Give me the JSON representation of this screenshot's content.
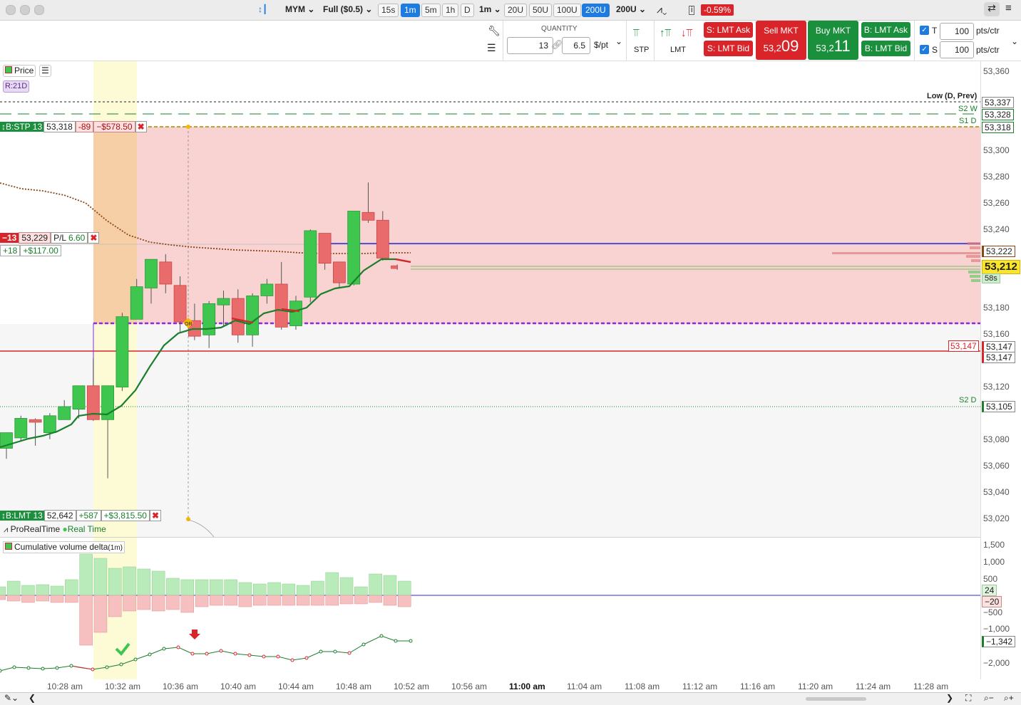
{
  "toolbar": {
    "symbol": "MYM",
    "data_mode": "Full ($0.5)",
    "timeframes": [
      "15s",
      "1m",
      "5m",
      "1h",
      "D"
    ],
    "active_timeframe": "1m",
    "interval": "1m",
    "ranges": [
      "20U",
      "50U",
      "100U",
      "200U"
    ],
    "active_range": "200U",
    "range_select": "200U",
    "change_pct": "-0.59%"
  },
  "order_entry": {
    "quantity_label": "QUANTITY",
    "quantity": "13",
    "dollar_per_pt": "6.5",
    "dollar_unit": "$/pt",
    "stp_label": "STP",
    "lmt_label": "LMT",
    "s_lmt_ask": "S: LMT Ask",
    "s_lmt_bid": "S: LMT Bid",
    "sell_mkt": "Sell MKT",
    "sell_price_small": "53,2",
    "sell_price_big": "09",
    "buy_mkt": "Buy MKT",
    "buy_price_small": "53,2",
    "buy_price_big": "11",
    "b_lmt_ask": "B: LMT Ask",
    "b_lmt_bid": "B: LMT Bid",
    "target_label": "T",
    "target_value": "100",
    "stop_label": "S",
    "stop_value": "100",
    "pts_unit": "pts/ctr"
  },
  "chart_header": {
    "price_button": "Price",
    "range_badge": "R:21D",
    "feed_name": "ProRealTime",
    "feed_status": "Real Time",
    "indicator": "Cumulative volume delta",
    "indicator_tf": "(1m)"
  },
  "orders": {
    "stop": {
      "label": "B:STP 13",
      "price": "53,318",
      "pts": "-89",
      "pnl": "−$578.50"
    },
    "position": {
      "qty": "−13",
      "price": "53,229",
      "pl_label": "P/L",
      "pl_value": "6.60",
      "pts": "+18",
      "pnl": "+$117.00"
    },
    "limit": {
      "label": "B:LMT 13",
      "price": "52,642",
      "pts": "+587",
      "pnl": "+$3,815.50"
    }
  },
  "level_labels": {
    "low_prev": "Low (D, Prev)",
    "s2w": "S2 W",
    "s1d": "S1 D",
    "s2d": "S2 D",
    "red_line_price": "53,147",
    "or_marker": "OR"
  },
  "price_axis": {
    "ticks": [
      "53,360",
      "53,300",
      "53,280",
      "53,260",
      "53,240",
      "53,180",
      "53,160",
      "53,120",
      "53,080",
      "53,060",
      "53,040",
      "53,020"
    ],
    "tags": {
      "low_prev": "53,337",
      "s2w": "53,328",
      "s1d": "53,318",
      "vwap": "53,222",
      "last": "53,212",
      "countdown": "58s",
      "red1": "53,147",
      "red2": "53,147",
      "s2d": "53,105"
    }
  },
  "cvd_axis": {
    "ticks": [
      "1,500",
      "1,000",
      "500",
      "−500",
      "−1,000",
      "−2,000"
    ],
    "tags": {
      "pos": "24",
      "neg": "−20",
      "cum": "−1,342"
    }
  },
  "time_axis": [
    "10:28 am",
    "10:32 am",
    "10:36 am",
    "10:40 am",
    "10:44 am",
    "10:48 am",
    "10:52 am",
    "10:56 am",
    "11:00 am",
    "11:04 am",
    "11:08 am",
    "11:12 am",
    "11:16 am",
    "11:20 am",
    "11:24 am",
    "11:28 am"
  ],
  "chart_data": {
    "type": "candlestick",
    "y_range": [
      53005,
      53370
    ],
    "candles": [
      {
        "o": 53073,
        "h": 53082,
        "l": 53065,
        "c": 53085
      },
      {
        "o": 53081,
        "h": 53098,
        "l": 53079,
        "c": 53096
      },
      {
        "o": 53095,
        "h": 53096,
        "l": 53075,
        "c": 53093
      },
      {
        "o": 53085,
        "h": 53100,
        "l": 53080,
        "c": 53098
      },
      {
        "o": 53095,
        "h": 53110,
        "l": 53095,
        "c": 53105
      },
      {
        "o": 53103,
        "h": 53120,
        "l": 53096,
        "c": 53121
      },
      {
        "o": 53121,
        "h": 53142,
        "l": 53094,
        "c": 53095
      },
      {
        "o": 53095,
        "h": 53120,
        "l": 53050,
        "c": 53121
      },
      {
        "o": 53120,
        "h": 53177,
        "l": 53117,
        "c": 53174
      },
      {
        "o": 53172,
        "h": 53203,
        "l": 53172,
        "c": 53197
      },
      {
        "o": 53196,
        "h": 53216,
        "l": 53184,
        "c": 53218
      },
      {
        "o": 53216,
        "h": 53222,
        "l": 53192,
        "c": 53199
      },
      {
        "o": 53198,
        "h": 53205,
        "l": 53162,
        "c": 53170
      },
      {
        "o": 53171,
        "h": 53184,
        "l": 53156,
        "c": 53159
      },
      {
        "o": 53160,
        "h": 53186,
        "l": 53150,
        "c": 53184
      },
      {
        "o": 53183,
        "h": 53194,
        "l": 53166,
        "c": 53188
      },
      {
        "o": 53188,
        "h": 53195,
        "l": 53154,
        "c": 53160
      },
      {
        "o": 53160,
        "h": 53192,
        "l": 53151,
        "c": 53190
      },
      {
        "o": 53190,
        "h": 53203,
        "l": 53184,
        "c": 53199
      },
      {
        "o": 53199,
        "h": 53216,
        "l": 53164,
        "c": 53166
      },
      {
        "o": 53167,
        "h": 53190,
        "l": 53164,
        "c": 53186
      },
      {
        "o": 53189,
        "h": 53241,
        "l": 53185,
        "c": 53240
      },
      {
        "o": 53238,
        "h": 53236,
        "l": 53210,
        "c": 53215
      },
      {
        "o": 53216,
        "h": 53215,
        "l": 53196,
        "c": 53200
      },
      {
        "o": 53199,
        "h": 53255,
        "l": 53198,
        "c": 53255
      },
      {
        "o": 53254,
        "h": 53277,
        "l": 53246,
        "c": 53248
      },
      {
        "o": 53248,
        "h": 53255,
        "l": 53217,
        "c": 53219
      },
      {
        "o": 53213,
        "h": 53214,
        "l": 53210,
        "c": 53211
      }
    ]
  },
  "colors": {
    "up": "#3ec64f",
    "down": "#e96b6b",
    "stop_zone": "#f9d2d2",
    "highlight": "#fcfbd6",
    "vwap_line": "#1a7f2a",
    "ma_dotted": "#8b4513",
    "open_range": "#8a2be2",
    "blue_line": "#2a2ad6"
  }
}
